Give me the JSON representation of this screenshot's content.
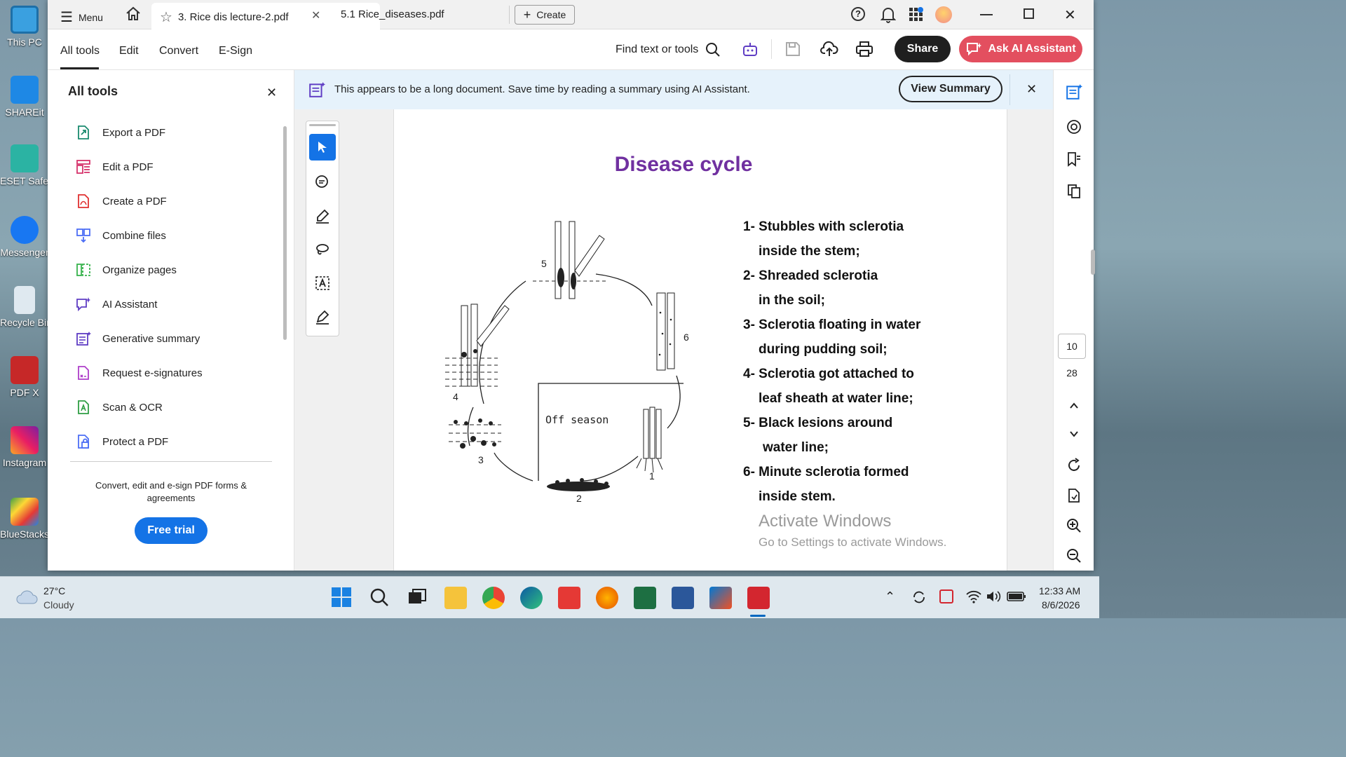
{
  "desktop": {
    "icons": [
      "This PC",
      "SHAREit",
      "ESET Safe Banking",
      "Messenger",
      "Recycle Bin",
      "PDF X",
      "Instagram",
      "BlueStacks"
    ]
  },
  "titlebar": {
    "menu_label": "Menu",
    "tabs": [
      {
        "label": "3. Rice dis lecture-2.pdf"
      },
      {
        "label": "5.1 Rice_diseases.pdf"
      }
    ],
    "create_label": "Create"
  },
  "toolbar": {
    "tabs": [
      "All tools",
      "Edit",
      "Convert",
      "E-Sign"
    ],
    "find_label": "Find text or tools",
    "share_label": "Share",
    "ai_label": "Ask AI Assistant"
  },
  "sidepanel": {
    "title": "All tools",
    "items": [
      {
        "label": "Export a PDF",
        "icon": "export-pdf-icon",
        "color": "#1a8a6e"
      },
      {
        "label": "Edit a PDF",
        "icon": "edit-pdf-icon",
        "color": "#d6336c"
      },
      {
        "label": "Create a PDF",
        "icon": "create-pdf-icon",
        "color": "#e03131"
      },
      {
        "label": "Combine files",
        "icon": "combine-files-icon",
        "color": "#4c6ef5"
      },
      {
        "label": "Organize pages",
        "icon": "organize-pages-icon",
        "color": "#37b24d"
      },
      {
        "label": "AI Assistant",
        "icon": "ai-assistant-icon",
        "color": "#5f3dc4"
      },
      {
        "label": "Generative summary",
        "icon": "generative-summary-icon",
        "color": "#5f3dc4"
      },
      {
        "label": "Request e-signatures",
        "icon": "esign-icon",
        "color": "#ae3ec9"
      },
      {
        "label": "Scan & OCR",
        "icon": "scan-ocr-icon",
        "color": "#2f9e44"
      },
      {
        "label": "Protect a PDF",
        "icon": "protect-pdf-icon",
        "color": "#4c6ef5"
      }
    ],
    "promo_text": "Convert, edit and e-sign PDF forms & agreements",
    "free_trial_label": "Free trial"
  },
  "banner": {
    "text": "This appears to be a long document. Save time by reading a summary using AI Assistant.",
    "button_label": "View Summary"
  },
  "document": {
    "title": "Disease cycle",
    "list": [
      "1- Stubbles with sclerotia",
      "inside the stem;",
      "2- Shreaded sclerotia",
      "in the soil;",
      "3- Sclerotia floating in water",
      "during pudding soil;",
      "4- Sclerotia got attached to",
      "leaf sheath at water line;",
      "5- Black lesions around",
      "water line;",
      "6- Minute sclerotia formed",
      "inside stem."
    ],
    "diagram_labels": [
      "5",
      "6",
      "4",
      "Off season",
      "3",
      "1",
      "2"
    ]
  },
  "pager": {
    "current": "10",
    "total": "28"
  },
  "watermark": {
    "line1": "Activate Windows",
    "line2": "Go to Settings to activate Windows."
  },
  "taskbar": {
    "weather_temp": "27°C",
    "weather_desc": "Cloudy",
    "time": "12:33 AM",
    "date": "8/6/2026"
  }
}
